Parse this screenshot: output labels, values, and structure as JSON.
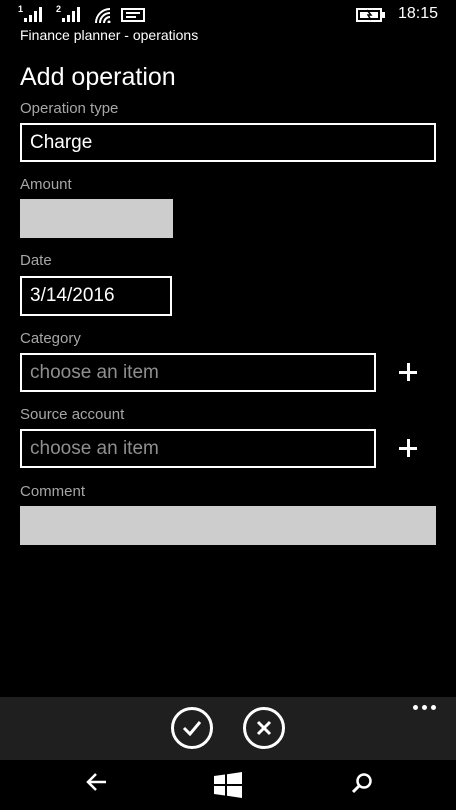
{
  "status": {
    "sim1": "1",
    "sim2": "2",
    "time": "18:15"
  },
  "app_title": "Finance planner - operations",
  "page_title": "Add operation",
  "fields": {
    "operation_type": {
      "label": "Operation type",
      "value": "Charge"
    },
    "amount": {
      "label": "Amount",
      "value": ""
    },
    "date": {
      "label": "Date",
      "value": "3/14/2016"
    },
    "category": {
      "label": "Category",
      "placeholder": "choose an item"
    },
    "source_account": {
      "label": "Source account",
      "placeholder": "choose an item"
    },
    "comment": {
      "label": "Comment",
      "value": ""
    }
  },
  "icons": {
    "accept": "check-circle-icon",
    "cancel": "close-circle-icon",
    "more": "ellipsis-icon",
    "back": "back-arrow-icon",
    "start": "windows-logo-icon",
    "search": "search-icon"
  },
  "colors": {
    "background": "#000000",
    "label": "#a6a6a6",
    "input_fill": "#cdcdcd",
    "app_bar": "#1f1f1f"
  }
}
